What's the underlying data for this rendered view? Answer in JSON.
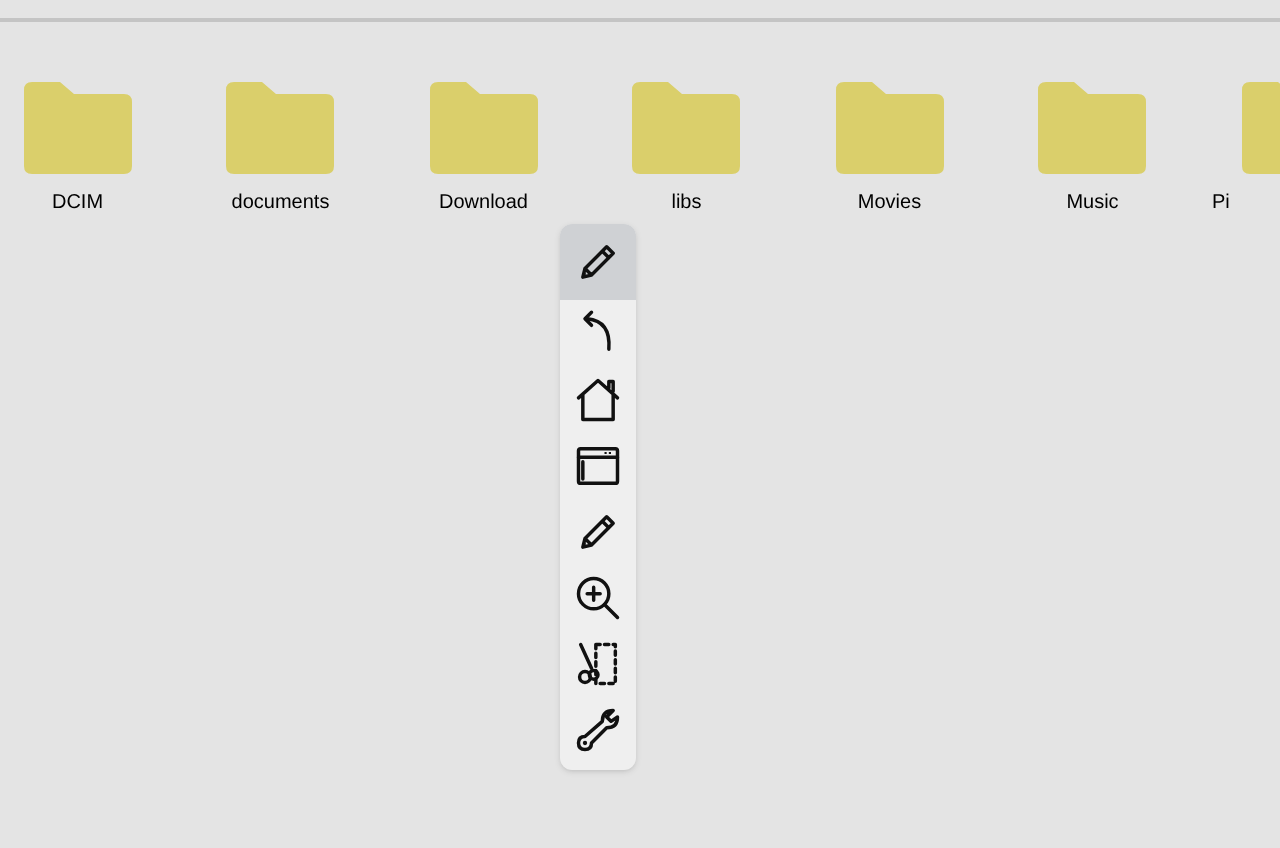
{
  "folders": [
    {
      "name": "DCIM"
    },
    {
      "name": "documents"
    },
    {
      "name": "Download"
    },
    {
      "name": "libs"
    },
    {
      "name": "Movies"
    },
    {
      "name": "Music"
    },
    {
      "name": "Pi"
    }
  ],
  "toolbar": {
    "items": [
      {
        "selected": true
      },
      {
        "selected": false
      },
      {
        "selected": false
      },
      {
        "selected": false
      },
      {
        "selected": false
      },
      {
        "selected": false
      },
      {
        "selected": false
      },
      {
        "selected": false
      }
    ]
  }
}
